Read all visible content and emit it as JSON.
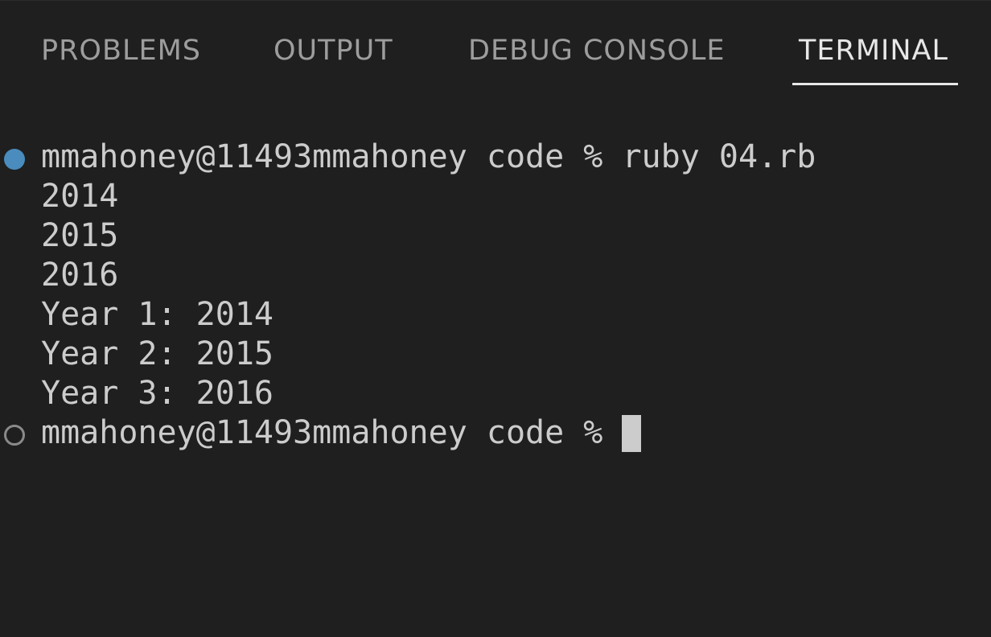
{
  "tabs": [
    {
      "label": "PROBLEMS",
      "active": false
    },
    {
      "label": "OUTPUT",
      "active": false
    },
    {
      "label": "DEBUG CONSOLE",
      "active": false
    },
    {
      "label": "TERMINAL",
      "active": true
    }
  ],
  "terminal": {
    "command_prompt": "mmahoney@11493mmahoney code % ruby 04.rb",
    "output": [
      "2014",
      "2015",
      "2016",
      "Year 1: 2014",
      "Year 2: 2015",
      "Year 3: 2016"
    ],
    "current_prompt": "mmahoney@11493mmahoney code % "
  },
  "colors": {
    "background": "#1f1f1f",
    "text": "#cccccc",
    "inactive_tab": "#9d9d9d",
    "active_tab": "#e7e7e7",
    "success_decoration": "#4a8cbd",
    "pending_decoration": "#8a8a8a"
  },
  "icons": {
    "command_status_done": "filled-circle",
    "command_status_pending": "hollow-circle",
    "cursor": "block-cursor"
  }
}
